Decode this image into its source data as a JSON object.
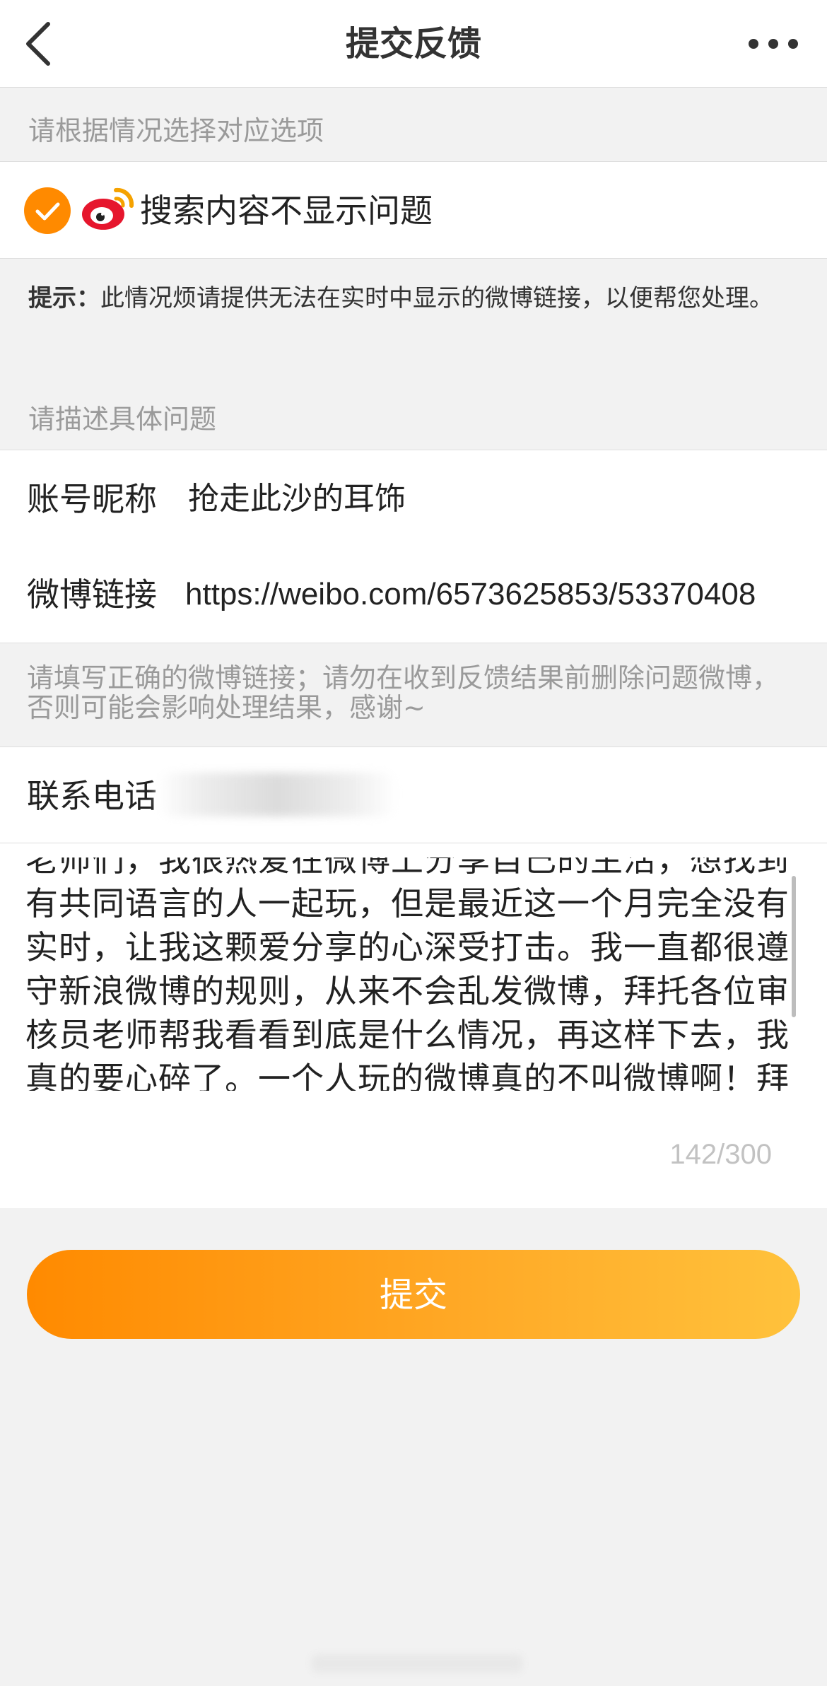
{
  "navbar": {
    "title": "提交反馈",
    "back_icon": "chevron-left-icon",
    "more_icon": "more-dots-icon"
  },
  "section1": {
    "label": "请根据情况选择对应选项",
    "option": "搜索内容不显示问题"
  },
  "tip": {
    "prefix": "提示：",
    "text": "此情况烦请提供无法在实时中显示的微博链接，以便帮您处理。"
  },
  "section2": {
    "label": "请描述具体问题"
  },
  "fields": {
    "nickname_label": "账号昵称",
    "nickname_value": "抢走此沙的耳饰",
    "link_label": "微博链接",
    "link_value": "https://weibo.com/6573625853/53370408",
    "link_note": "请填写正确的微博链接；请勿在收到反馈结果前删除问题微博，否则可能会影响处理结果，感谢~",
    "phone_label": "联系电话"
  },
  "description": {
    "text": "老师们，我很热爱在微博上分享自己的生活，想找到有共同语言的人一起玩，但是最近这一个月完全没有实时，让我这颗爱分享的心深受打击。我一直都很遵守新浪微博的规则，从来不会乱发微博，拜托各位审核员老师帮我看看到底是什么情况，再这样下去，我真的要心碎了。一个人玩的微博真的不叫微博啊！拜",
    "counter": "142/300"
  },
  "submit": {
    "label": "提交"
  },
  "colors": {
    "accent": "#ff8a00",
    "accent_end": "#ffc23c",
    "background": "#f2f2f2"
  }
}
